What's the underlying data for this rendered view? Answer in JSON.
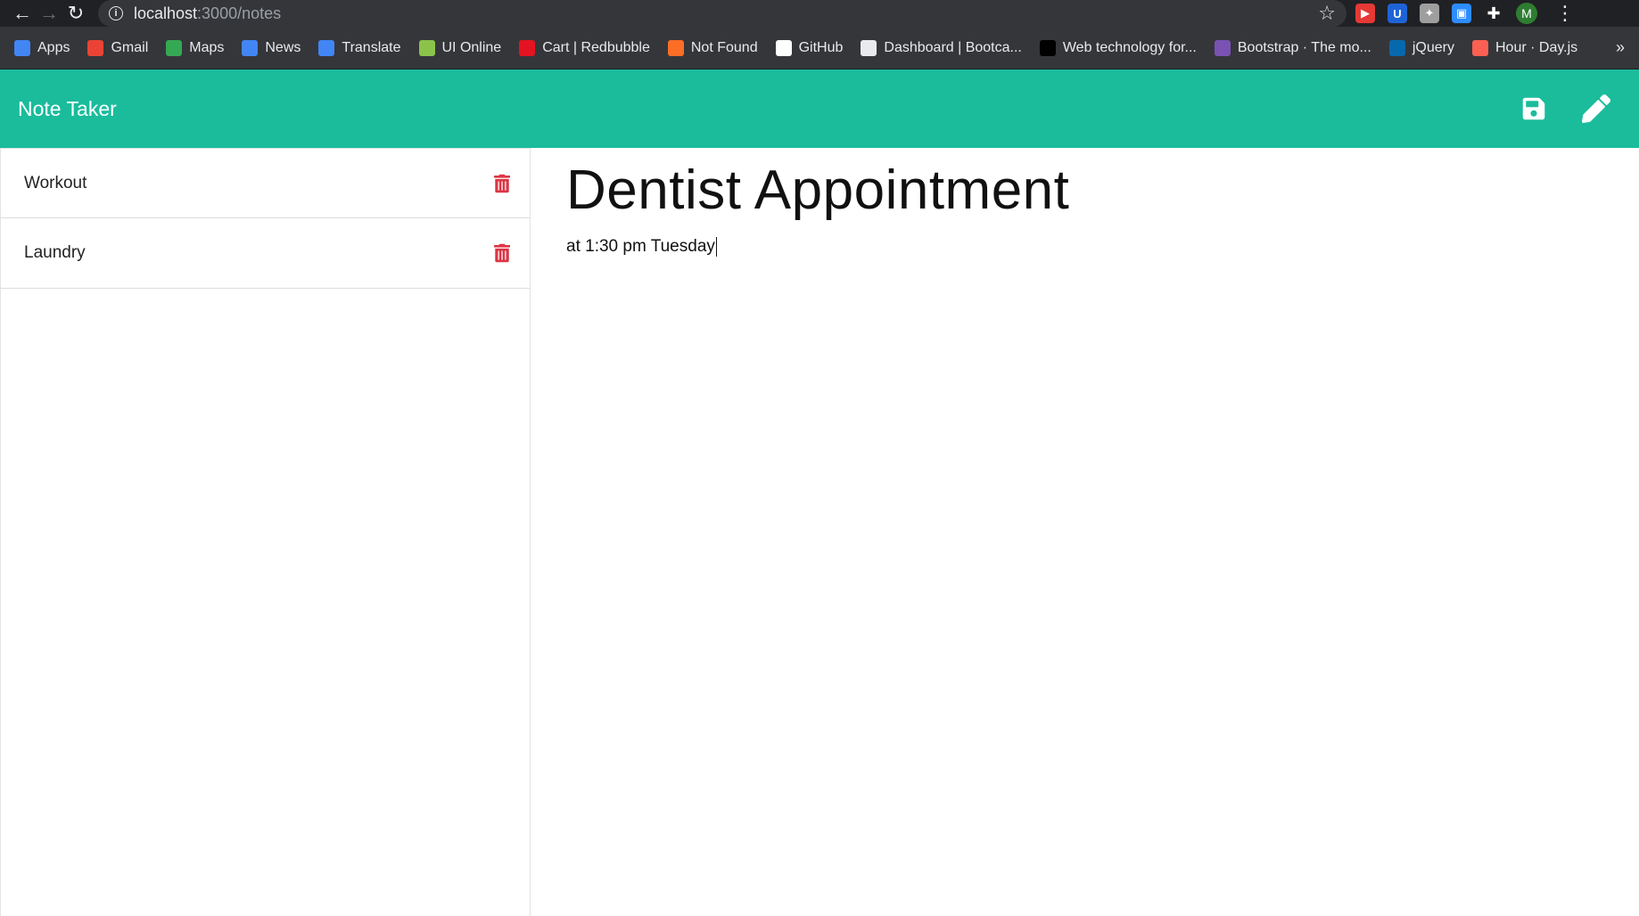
{
  "browser": {
    "url_host": "localhost",
    "url_path": ":3000/notes",
    "bookmarks": [
      {
        "label": "Apps",
        "icon": "apps-grid-icon",
        "color": "#4285f4"
      },
      {
        "label": "Gmail",
        "icon": "gmail-icon",
        "color": "#ea4335"
      },
      {
        "label": "Maps",
        "icon": "maps-icon",
        "color": "#34a853"
      },
      {
        "label": "News",
        "icon": "news-icon",
        "color": "#4285f4"
      },
      {
        "label": "Translate",
        "icon": "translate-icon",
        "color": "#4285f4"
      },
      {
        "label": "UI Online",
        "icon": "ui-online-icon",
        "color": "#8bc34a"
      },
      {
        "label": "Cart | Redbubble",
        "icon": "redbubble-icon",
        "color": "#e41321"
      },
      {
        "label": "Not Found",
        "icon": "gitlab-icon",
        "color": "#fc6d26"
      },
      {
        "label": "GitHub",
        "icon": "github-icon",
        "color": "#ffffff"
      },
      {
        "label": "Dashboard | Bootca...",
        "icon": "globe-icon",
        "color": "#e8eaed"
      },
      {
        "label": "Web technology for...",
        "icon": "mdn-icon",
        "color": "#000000"
      },
      {
        "label": "Bootstrap · The mo...",
        "icon": "bootstrap-icon",
        "color": "#7952b3"
      },
      {
        "label": "jQuery",
        "icon": "jquery-icon",
        "color": "#0769ad"
      },
      {
        "label": "Hour · Day.js",
        "icon": "dayjs-icon",
        "color": "#fb6052"
      }
    ],
    "more_bookmarks": "»",
    "avatar_initial": "M"
  },
  "app": {
    "brand": "Note Taker",
    "accent_color": "#1abc9c",
    "delete_color": "#dc3545",
    "notes": [
      {
        "title": "Workout"
      },
      {
        "title": "Laundry"
      }
    ],
    "active_note": {
      "title": "Dentist Appointment",
      "text": "at 1:30 pm Tuesday"
    }
  }
}
